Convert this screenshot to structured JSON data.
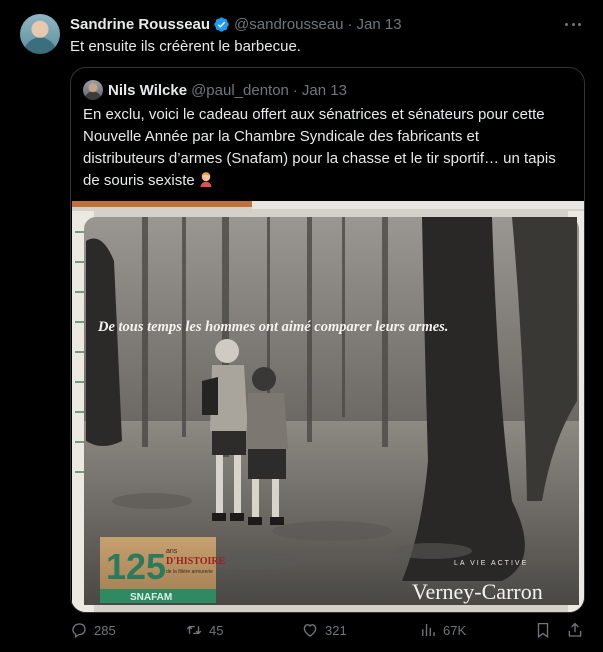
{
  "tweet": {
    "display_name": "Sandrine Rousseau",
    "handle": "@sandrousseau",
    "separator": "·",
    "time": "Jan 13",
    "text": "Et ensuite ils créèrent le barbecue.",
    "verified_icon": "verified-badge-icon",
    "more_icon": "more-dots-icon"
  },
  "quote": {
    "display_name": "Nils Wilcke",
    "handle": "@paul_denton",
    "separator": "·",
    "time": "Jan 13",
    "text": "En exclu, voici le cadeau offert aux sénatrices et sénateurs pour cette Nouvelle Année par la Chambre Syndicale des fabricants et distributeurs d’armes (Snafam) pour la chasse et le tir sportif… un tapis de souris sexiste",
    "emoji": "facepalm-emoji",
    "image": {
      "caption": "De tous temps les hommes ont aimé comparer leurs armes.",
      "badge_number": "125",
      "badge_line1": "ans",
      "badge_line2": "D'HISTOIRE",
      "badge_line3": "de la filière armurerie",
      "badge_brand": "SNAFAM",
      "brand": "Verney-Carron",
      "brand_tagline": "LA VIE ACTIVE"
    }
  },
  "actions": {
    "replies": "285",
    "retweets": "45",
    "likes": "321",
    "views": "67K",
    "icons": [
      "reply-icon",
      "retweet-icon",
      "like-icon",
      "views-icon",
      "bookmark-icon",
      "share-icon"
    ]
  },
  "colors": {
    "background": "#000000",
    "text": "#e7e9ea",
    "muted": "#71767b",
    "border": "#2f3336",
    "verified": "#1d9bf0"
  }
}
